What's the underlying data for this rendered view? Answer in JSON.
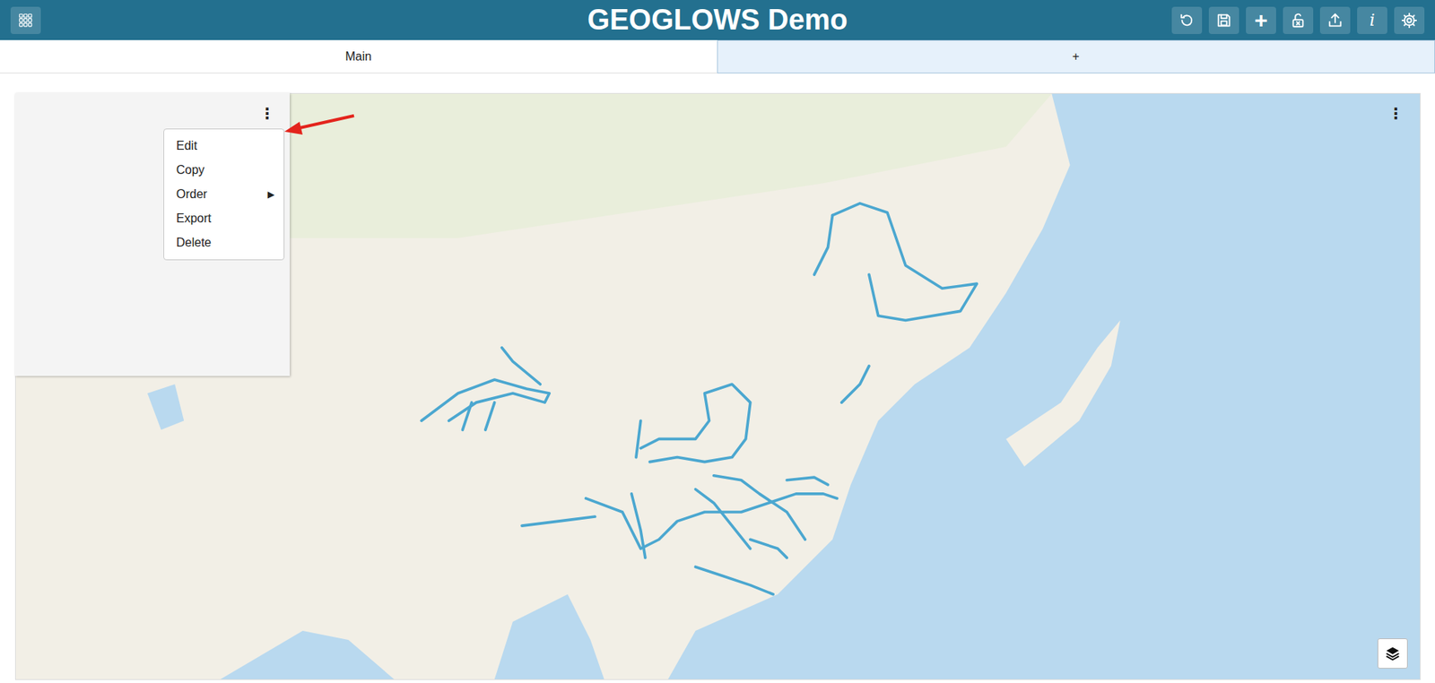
{
  "header": {
    "title": "GEOGLOWS Demo",
    "add_icon": "+",
    "info_icon": "i"
  },
  "tabs": [
    {
      "label": "Main",
      "selected": true
    },
    {
      "label": "+",
      "selected": false
    }
  ],
  "panel": {
    "menu_icon": "⋮",
    "menu": {
      "open": true,
      "items": [
        {
          "label": "Edit"
        },
        {
          "label": "Copy"
        },
        {
          "label": "Order",
          "arrow": "▶"
        },
        {
          "label": "Export"
        },
        {
          "label": "Delete"
        }
      ]
    }
  },
  "map": {
    "menu_icon": "⋮"
  }
}
